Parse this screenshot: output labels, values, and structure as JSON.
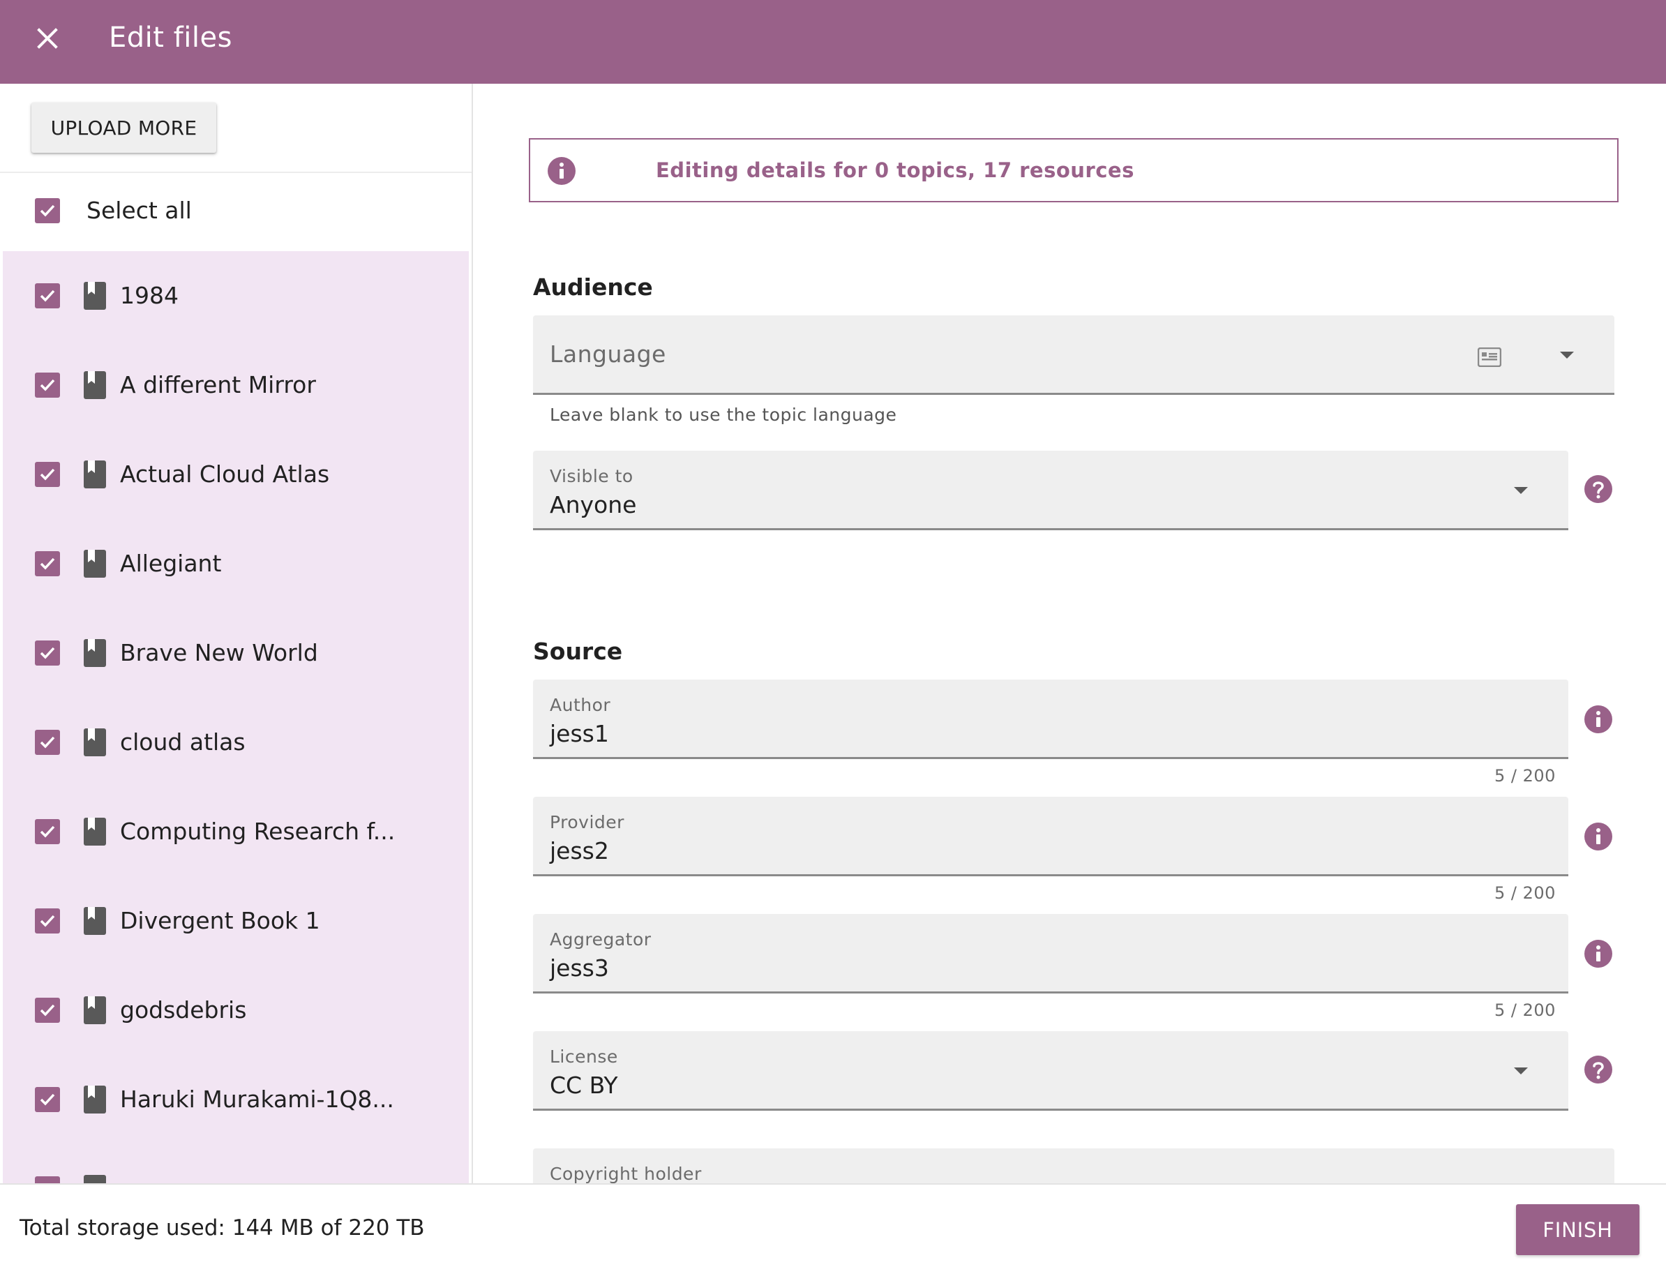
{
  "header": {
    "title": "Edit files"
  },
  "sidebar": {
    "upload_label": "UPLOAD MORE",
    "select_all_label": "Select all",
    "files": [
      {
        "label": "1984"
      },
      {
        "label": "A different Mirror"
      },
      {
        "label": "Actual Cloud Atlas"
      },
      {
        "label": "Allegiant"
      },
      {
        "label": "Brave New World"
      },
      {
        "label": "cloud atlas"
      },
      {
        "label": "Computing Research f..."
      },
      {
        "label": "Divergent Book 1"
      },
      {
        "label": "godsdebris"
      },
      {
        "label": "Haruki Murakami-1Q8..."
      }
    ]
  },
  "main": {
    "info_banner": "Editing details for 0 topics, 17 resources",
    "audience": {
      "title": "Audience",
      "language_placeholder": "Language",
      "language_help": "Leave blank to use the topic language",
      "visible_to_label": "Visible to",
      "visible_to_value": "Anyone"
    },
    "source": {
      "title": "Source",
      "author_label": "Author",
      "author_value": "jess1",
      "author_count": "5 / 200",
      "provider_label": "Provider",
      "provider_value": "jess2",
      "provider_count": "5 / 200",
      "aggregator_label": "Aggregator",
      "aggregator_value": "jess3",
      "aggregator_count": "5 / 200",
      "license_label": "License",
      "license_value": "CC BY",
      "copyright_label": "Copyright holder"
    }
  },
  "footer": {
    "storage": "Total storage used: 144 MB of 220 TB",
    "finish_label": "FINISH"
  },
  "colors": {
    "brand": "#996189",
    "list_background": "#f2e5f3",
    "field_background": "#efefef"
  },
  "icons": {
    "close": "close-icon",
    "checkbox": "checkmark-icon",
    "document": "document-icon",
    "info": "info-icon",
    "help": "help-icon",
    "language": "language-card-icon",
    "dropdown": "chevron-down-icon"
  }
}
